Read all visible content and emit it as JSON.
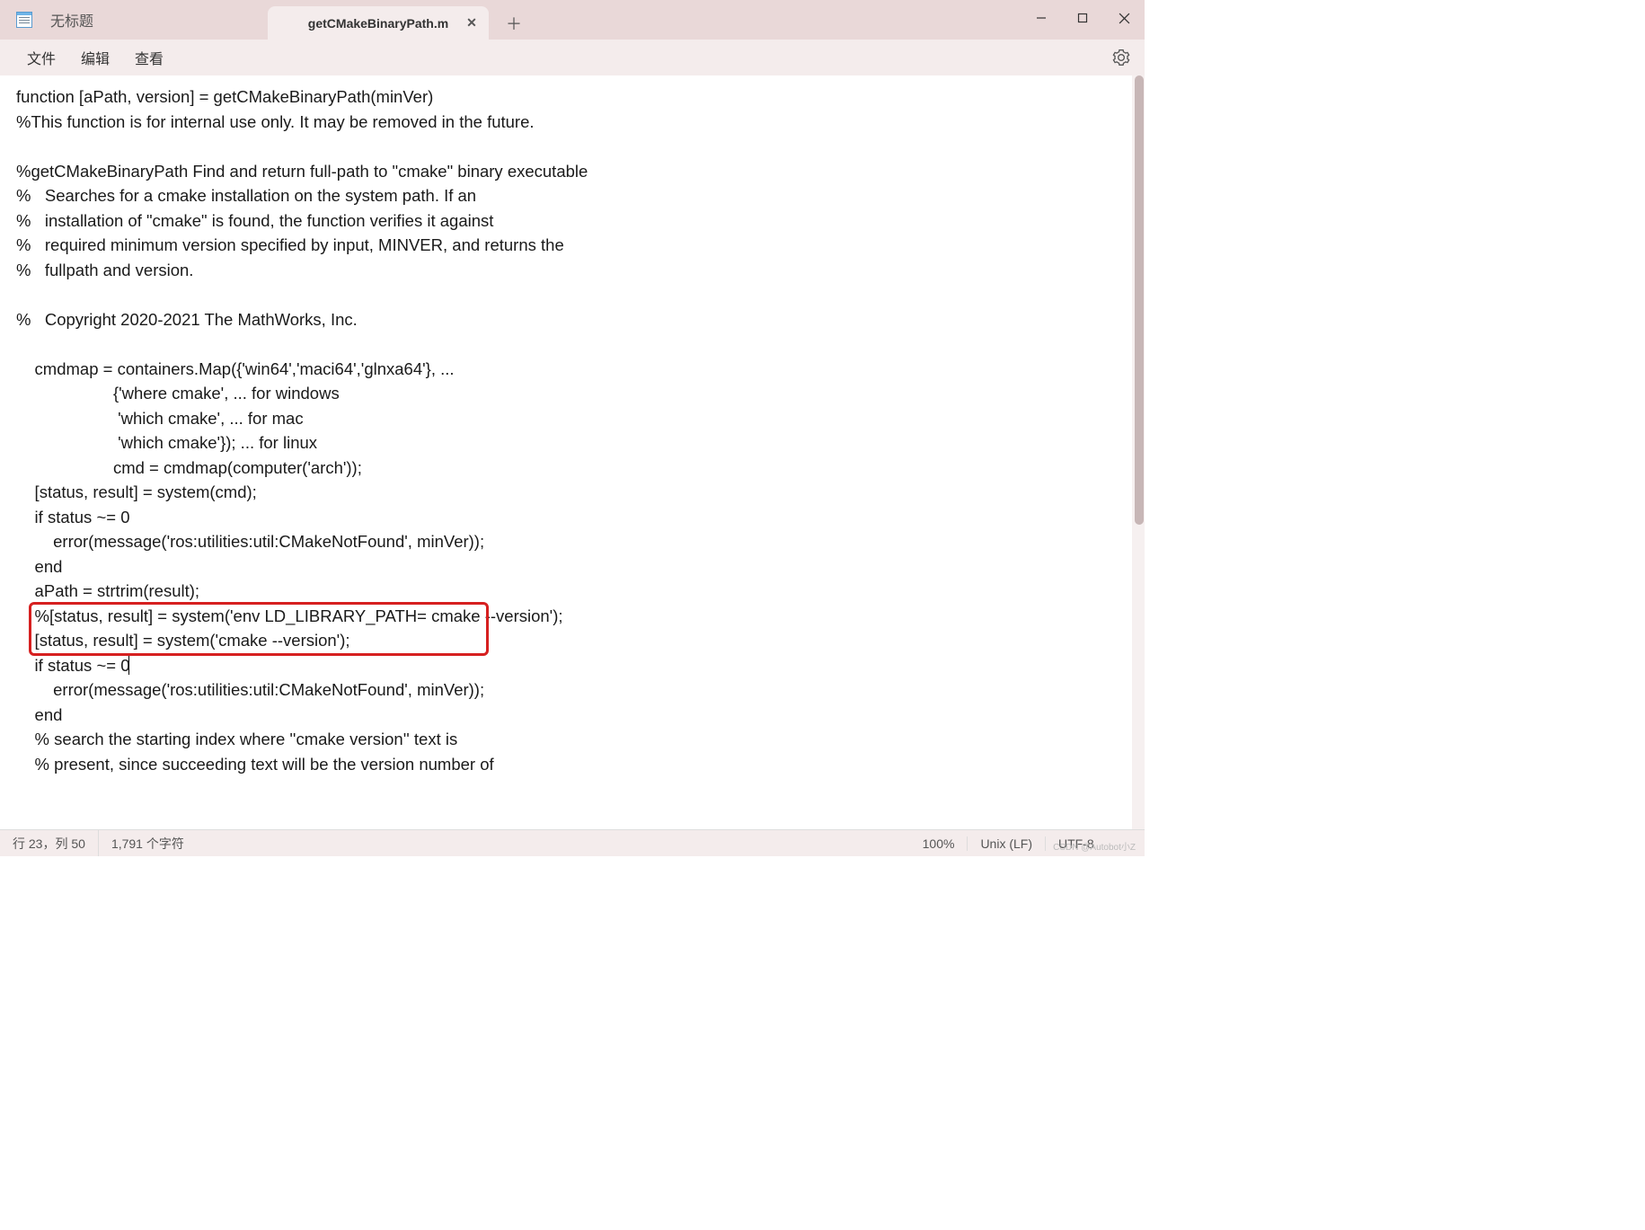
{
  "titlebar": {
    "untitled_label": "无标题"
  },
  "tabs": {
    "active_label": "getCMakeBinaryPath.m"
  },
  "menubar": {
    "file": "文件",
    "edit": "编辑",
    "view": "查看"
  },
  "code": {
    "l1": "function [aPath, version] = getCMakeBinaryPath(minVer)",
    "l2": "%This function is for internal use only. It may be removed in the future.",
    "l3": "",
    "l4": "%getCMakeBinaryPath Find and return full-path to \"cmake\" binary executable",
    "l5": "%   Searches for a cmake installation on the system path. If an",
    "l6": "%   installation of \"cmake\" is found, the function verifies it against",
    "l7": "%   required minimum version specified by input, MINVER, and returns the",
    "l8": "%   fullpath and version.",
    "l9": "",
    "l10": "%   Copyright 2020-2021 The MathWorks, Inc.",
    "l11": "",
    "l12": "    cmdmap = containers.Map({'win64','maci64','glnxa64'}, ...",
    "l13": "                     {'where cmake', ... for windows",
    "l14": "                      'which cmake', ... for mac",
    "l15": "                      'which cmake'}); ... for linux",
    "l16": "                     cmd = cmdmap(computer('arch'));",
    "l17": "    [status, result] = system(cmd);",
    "l18": "    if status ~= 0",
    "l19": "        error(message('ros:utilities:util:CMakeNotFound', minVer));",
    "l20": "    end",
    "l21": "    aPath = strtrim(result);",
    "l22": "    %[status, result] = system('env LD_LIBRARY_PATH= cmake --version');",
    "l23": "    [status, result] = system('cmake --version');",
    "l24": "    if status ~= 0",
    "l25": "        error(message('ros:utilities:util:CMakeNotFound', minVer));",
    "l26": "    end",
    "l27": "    % search the starting index where ''cmake version'' text is",
    "l28": "    % present, since succeeding text will be the version number of"
  },
  "statusbar": {
    "position": "行 23，列 50",
    "chars": "1,791 个字符",
    "zoom": "100%",
    "lineend": "Unix (LF)",
    "encoding": "UTF-8"
  },
  "watermark": "CSDN @Autobot小Z"
}
